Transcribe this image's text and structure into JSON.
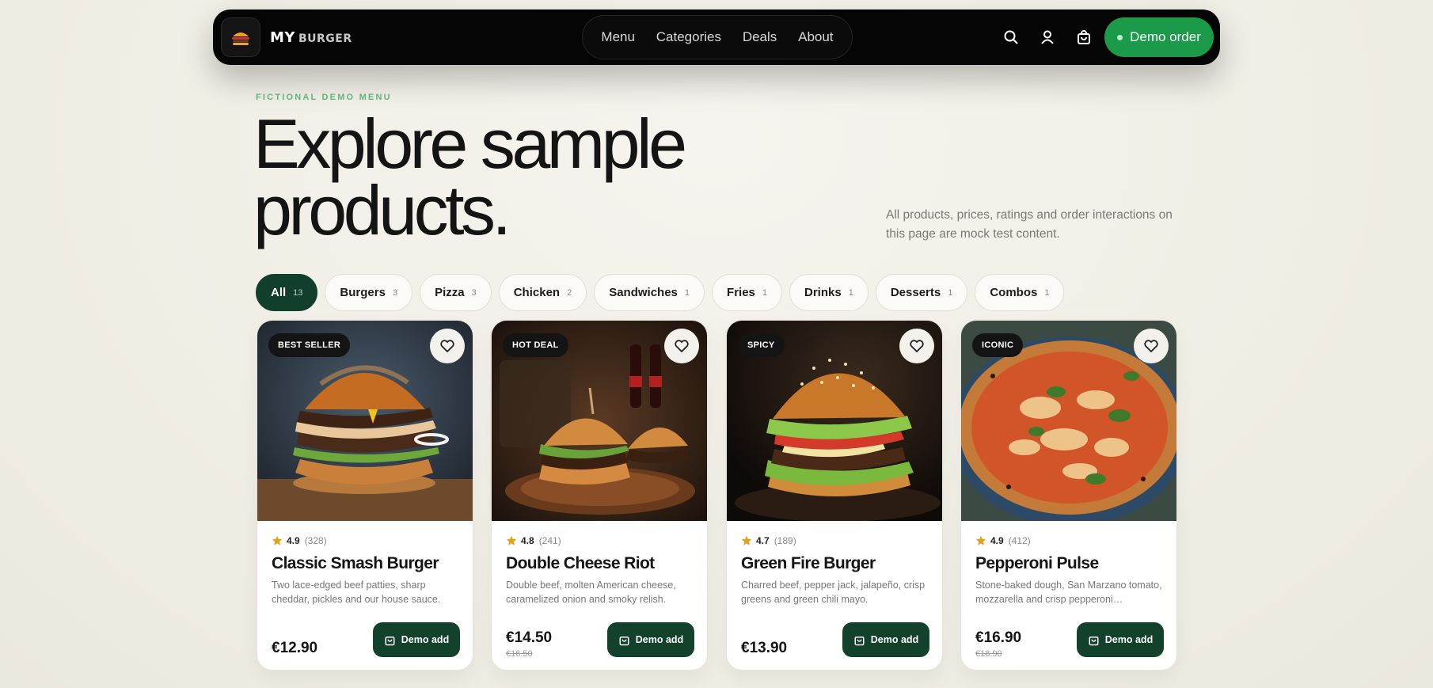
{
  "brand": {
    "name": "MY",
    "sub": "BURGER"
  },
  "nav": {
    "links": [
      "Menu",
      "Categories",
      "Deals",
      "About"
    ],
    "cta": "Demo order"
  },
  "hero": {
    "eyebrow": "FICTIONAL DEMO MENU",
    "title_line1": "Explore sample",
    "title_line2": "products.",
    "description": "All products, prices, ratings and order interactions on this page are mock test content."
  },
  "categories": [
    {
      "label": "All",
      "count": "13",
      "active": true
    },
    {
      "label": "Burgers",
      "count": "3"
    },
    {
      "label": "Pizza",
      "count": "3"
    },
    {
      "label": "Chicken",
      "count": "2"
    },
    {
      "label": "Sandwiches",
      "count": "1"
    },
    {
      "label": "Fries",
      "count": "1"
    },
    {
      "label": "Drinks",
      "count": "1"
    },
    {
      "label": "Desserts",
      "count": "1"
    },
    {
      "label": "Combos",
      "count": "1"
    }
  ],
  "products": [
    {
      "badge": "BEST SELLER",
      "rating": "4.9",
      "reviews": "(328)",
      "name": "Classic Smash Burger",
      "description": "Two lace-edged beef patties, sharp cheddar, pickles and our house sauce.",
      "price": "€12.90",
      "old_price": "",
      "button": "Demo add"
    },
    {
      "badge": "HOT DEAL",
      "rating": "4.8",
      "reviews": "(241)",
      "name": "Double Cheese Riot",
      "description": "Double beef, molten American cheese, caramelized onion and smoky relish.",
      "price": "€14.50",
      "old_price": "€16.50",
      "button": "Demo add"
    },
    {
      "badge": "SPICY",
      "rating": "4.7",
      "reviews": "(189)",
      "name": "Green Fire Burger",
      "description": "Charred beef, pepper jack, jalapeño, crisp greens and green chili mayo.",
      "price": "€13.90",
      "old_price": "",
      "button": "Demo add"
    },
    {
      "badge": "ICONIC",
      "rating": "4.9",
      "reviews": "(412)",
      "name": "Pepperoni Pulse",
      "description": "Stone-baked dough, San Marzano tomato, mozzarella and crisp pepperoni…",
      "price": "€16.90",
      "old_price": "€18.90",
      "button": "Demo add"
    }
  ],
  "colors": {
    "accent": "#1b9a49",
    "dark_green": "#12412c",
    "star": "#e3a21a"
  }
}
